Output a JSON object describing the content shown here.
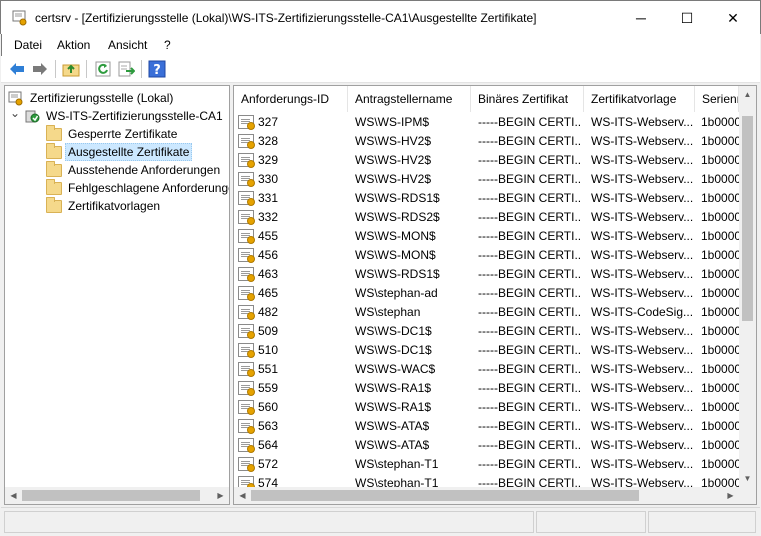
{
  "window": {
    "title": "certsrv - [Zertifizierungsstelle (Lokal)\\WS-ITS-Zertifizierungsstelle-CA1\\Ausgestellte Zertifikate]",
    "minimize": "─",
    "maximize": "☐",
    "close": "✕"
  },
  "menu": {
    "datei": "Datei",
    "aktion": "Aktion",
    "ansicht": "Ansicht",
    "help": "?"
  },
  "toolbar": {
    "icons": [
      "back-arrow-icon",
      "forward-arrow-icon",
      "up-folder-icon",
      "refresh-icon",
      "export-list-icon",
      "help-icon"
    ]
  },
  "tree": {
    "root": "Zertifizierungsstelle (Lokal)",
    "ca": "WS-ITS-Zertifizierungsstelle-CA1",
    "expander": "⌄",
    "items": [
      "Gesperrte Zertifikate",
      "Ausgestellte Zertifikate",
      "Ausstehende Anforderungen",
      "Fehlgeschlagene Anforderungen",
      "Zertifikatvorlagen"
    ]
  },
  "list": {
    "columns": [
      "Anforderungs-ID",
      "Antragstellername",
      "Binäres Zertifikat",
      "Zertifikatvorlage",
      "Seriennummer"
    ],
    "rows": [
      {
        "id": "327",
        "name": "WS\\WS-IPM$",
        "bin": "-----BEGIN CERTI...",
        "tmpl": "WS-ITS-Webserv...",
        "serial": "1b0000"
      },
      {
        "id": "328",
        "name": "WS\\WS-HV2$",
        "bin": "-----BEGIN CERTI...",
        "tmpl": "WS-ITS-Webserv...",
        "serial": "1b0000"
      },
      {
        "id": "329",
        "name": "WS\\WS-HV2$",
        "bin": "-----BEGIN CERTI...",
        "tmpl": "WS-ITS-Webserv...",
        "serial": "1b0000"
      },
      {
        "id": "330",
        "name": "WS\\WS-HV2$",
        "bin": "-----BEGIN CERTI...",
        "tmpl": "WS-ITS-Webserv...",
        "serial": "1b0000"
      },
      {
        "id": "331",
        "name": "WS\\WS-RDS1$",
        "bin": "-----BEGIN CERTI...",
        "tmpl": "WS-ITS-Webserv...",
        "serial": "1b0000"
      },
      {
        "id": "332",
        "name": "WS\\WS-RDS2$",
        "bin": "-----BEGIN CERTI...",
        "tmpl": "WS-ITS-Webserv...",
        "serial": "1b0000"
      },
      {
        "id": "455",
        "name": "WS\\WS-MON$",
        "bin": "-----BEGIN CERTI...",
        "tmpl": "WS-ITS-Webserv...",
        "serial": "1b0000"
      },
      {
        "id": "456",
        "name": "WS\\WS-MON$",
        "bin": "-----BEGIN CERTI...",
        "tmpl": "WS-ITS-Webserv...",
        "serial": "1b0000"
      },
      {
        "id": "463",
        "name": "WS\\WS-RDS1$",
        "bin": "-----BEGIN CERTI...",
        "tmpl": "WS-ITS-Webserv...",
        "serial": "1b0000"
      },
      {
        "id": "465",
        "name": "WS\\stephan-ad",
        "bin": "-----BEGIN CERTI...",
        "tmpl": "WS-ITS-Webserv...",
        "serial": "1b0000"
      },
      {
        "id": "482",
        "name": "WS\\stephan",
        "bin": "-----BEGIN CERTI...",
        "tmpl": "WS-ITS-CodeSig...",
        "serial": "1b0000"
      },
      {
        "id": "509",
        "name": "WS\\WS-DC1$",
        "bin": "-----BEGIN CERTI...",
        "tmpl": "WS-ITS-Webserv...",
        "serial": "1b0000"
      },
      {
        "id": "510",
        "name": "WS\\WS-DC1$",
        "bin": "-----BEGIN CERTI...",
        "tmpl": "WS-ITS-Webserv...",
        "serial": "1b0000"
      },
      {
        "id": "551",
        "name": "WS\\WS-WAC$",
        "bin": "-----BEGIN CERTI...",
        "tmpl": "WS-ITS-Webserv...",
        "serial": "1b0000"
      },
      {
        "id": "559",
        "name": "WS\\WS-RA1$",
        "bin": "-----BEGIN CERTI...",
        "tmpl": "WS-ITS-Webserv...",
        "serial": "1b0000"
      },
      {
        "id": "560",
        "name": "WS\\WS-RA1$",
        "bin": "-----BEGIN CERTI...",
        "tmpl": "WS-ITS-Webserv...",
        "serial": "1b0000"
      },
      {
        "id": "563",
        "name": "WS\\WS-ATA$",
        "bin": "-----BEGIN CERTI...",
        "tmpl": "WS-ITS-Webserv...",
        "serial": "1b0000"
      },
      {
        "id": "564",
        "name": "WS\\WS-ATA$",
        "bin": "-----BEGIN CERTI...",
        "tmpl": "WS-ITS-Webserv...",
        "serial": "1b0000"
      },
      {
        "id": "572",
        "name": "WS\\stephan-T1",
        "bin": "-----BEGIN CERTI...",
        "tmpl": "WS-ITS-Webserv...",
        "serial": "1b0000"
      },
      {
        "id": "574",
        "name": "WS\\stephan-T1",
        "bin": "-----BEGIN CERTI...",
        "tmpl": "WS-ITS-Webserv...",
        "serial": "1b0000"
      }
    ]
  },
  "scroll": {
    "left": "◀",
    "right": "▶",
    "up": "▲",
    "down": "▼"
  }
}
